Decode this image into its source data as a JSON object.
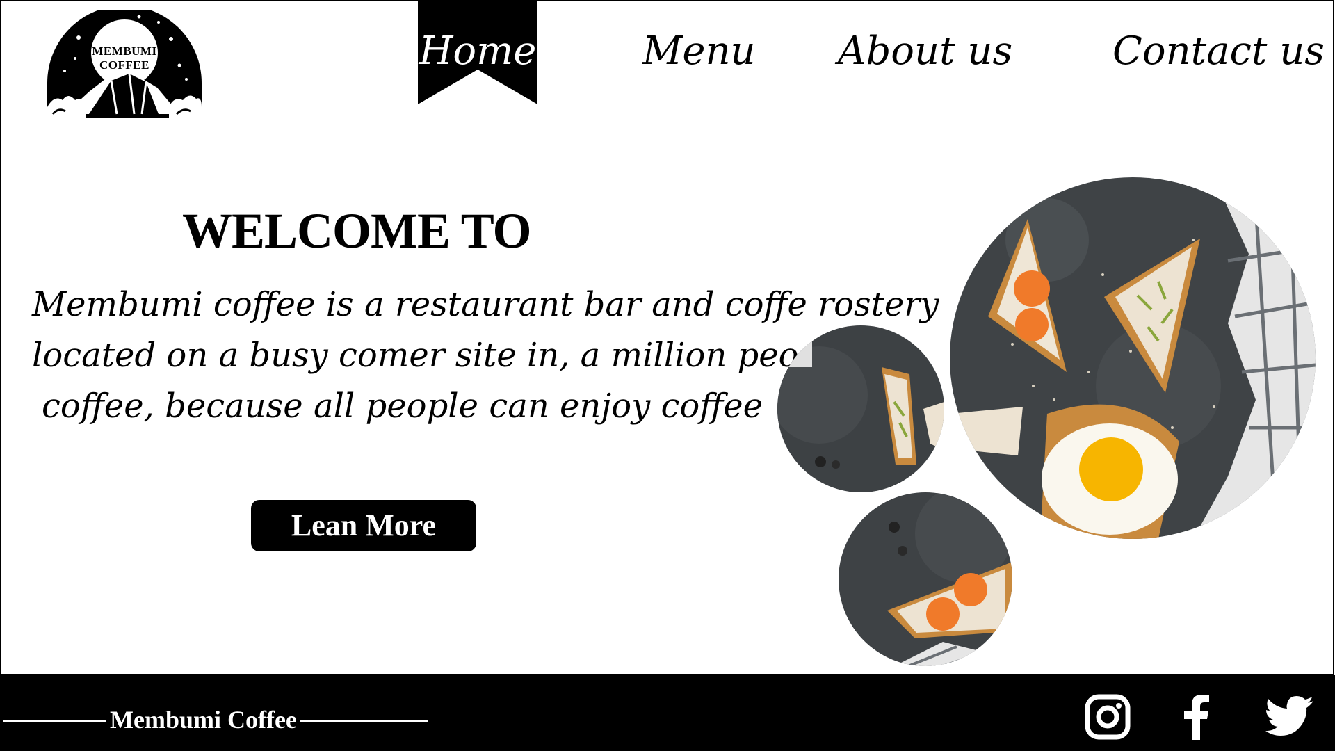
{
  "logo": {
    "line1": "MEMBUMI",
    "line2": "COFFEE"
  },
  "nav": {
    "items": [
      {
        "label": "Home",
        "active": true
      },
      {
        "label": "Menu",
        "active": false
      },
      {
        "label": "About us",
        "active": false
      },
      {
        "label": "Contact us",
        "active": false
      }
    ]
  },
  "hero": {
    "heading": "WELCOME TO",
    "description_lines": [
      "Membumi coffee is a restaurant bar and coffe rostery",
      "located on a busy comer site in, a million people's",
      "coffee, because all people can enjoy coffee"
    ],
    "button_label": "Lean More"
  },
  "footer": {
    "brand": "Membumi Coffee",
    "social": [
      "instagram-icon",
      "facebook-icon",
      "twitter-icon"
    ]
  },
  "colors": {
    "primary": "#000000",
    "background": "#ffffff",
    "accent_orange": "#f07a2a",
    "accent_yolk": "#f7b500"
  }
}
